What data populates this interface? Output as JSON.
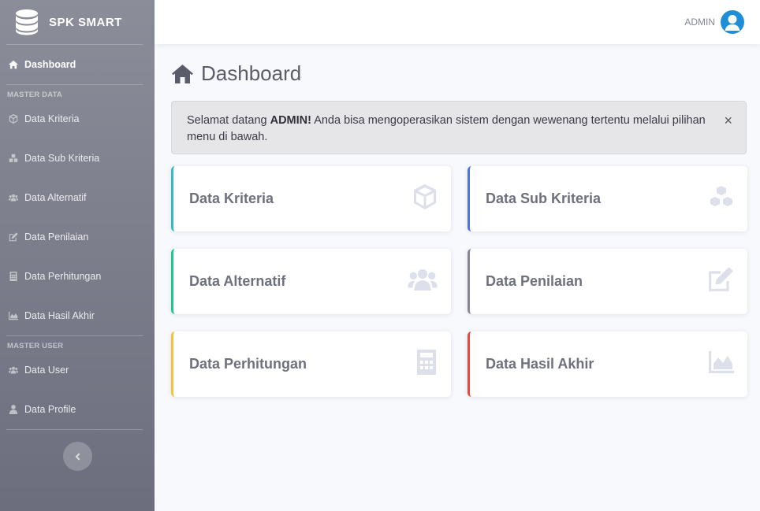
{
  "app": {
    "brand": "SPK SMART"
  },
  "sidebar": {
    "dashboard_label": "Dashboard",
    "master_data_heading": "MASTER DATA",
    "items": [
      {
        "label": "Data Kriteria",
        "icon": "cube-icon"
      },
      {
        "label": "Data Sub Kriteria",
        "icon": "cubes-icon"
      },
      {
        "label": "Data Alternatif",
        "icon": "users-icon"
      },
      {
        "label": "Data Penilaian",
        "icon": "edit-icon"
      },
      {
        "label": "Data Perhitungan",
        "icon": "calculator-icon"
      },
      {
        "label": "Data Hasil Akhir",
        "icon": "area-chart-icon"
      }
    ],
    "master_user_heading": "MASTER USER",
    "user_items": [
      {
        "label": "Data User",
        "icon": "users-cog-icon"
      },
      {
        "label": "Data Profile",
        "icon": "user-icon"
      }
    ]
  },
  "topbar": {
    "user_name": "ADMIN"
  },
  "main": {
    "title": "Dashboard",
    "alert": {
      "prefix": "Selamat datang ",
      "name": "ADMIN!",
      "suffix": " Anda bisa mengoperasikan sistem dengan wewenang tertentu melalui pilihan menu di bawah.",
      "close": "×"
    },
    "cards": [
      {
        "title": "Data Kriteria",
        "accent": "#36b9cc",
        "icon": "cube-icon"
      },
      {
        "title": "Data Sub Kriteria",
        "accent": "#4e73df",
        "icon": "cubes-icon"
      },
      {
        "title": "Data Alternatif",
        "accent": "#1cc88a",
        "icon": "users-icon"
      },
      {
        "title": "Data Penilaian",
        "accent": "#858796",
        "icon": "edit-icon"
      },
      {
        "title": "Data Perhitungan",
        "accent": "#f6c23e",
        "icon": "calculator-icon"
      },
      {
        "title": "Data Hasil Akhir",
        "accent": "#e74a3b",
        "icon": "area-chart-icon"
      }
    ]
  },
  "colors": {
    "sidebar_top": "#8b8d99",
    "sidebar_bottom": "#6c6e7e",
    "avatar": "#1e8fd6"
  }
}
